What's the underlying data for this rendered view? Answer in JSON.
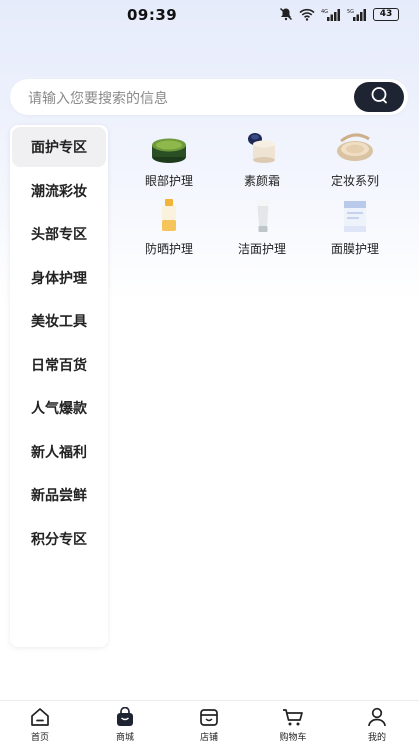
{
  "status_bar": {
    "time": "09:39",
    "battery": "43",
    "network_labels": [
      "4G",
      "5G"
    ]
  },
  "search": {
    "placeholder": "请输入您要搜索的信息",
    "icon": "search-icon"
  },
  "sidebar": {
    "active_index": 0,
    "items": [
      {
        "label": "面护专区"
      },
      {
        "label": "潮流彩妆"
      },
      {
        "label": "头部专区"
      },
      {
        "label": "身体护理"
      },
      {
        "label": "美妆工具"
      },
      {
        "label": "日常百货"
      },
      {
        "label": "人气爆款"
      },
      {
        "label": "新人福利"
      },
      {
        "label": "新品尝鲜"
      },
      {
        "label": "积分专区"
      }
    ]
  },
  "categories": [
    {
      "label": "眼部护理",
      "icon": "eye-patch-jar-icon"
    },
    {
      "label": "素颜霜",
      "icon": "cream-jar-icon"
    },
    {
      "label": "定妆系列",
      "icon": "powder-compact-icon"
    },
    {
      "label": "防晒护理",
      "icon": "sunscreen-bottle-icon"
    },
    {
      "label": "洁面护理",
      "icon": "cleanser-tube-icon"
    },
    {
      "label": "面膜护理",
      "icon": "face-mask-box-icon"
    }
  ],
  "tabs": [
    {
      "label": "首页",
      "icon": "home-icon"
    },
    {
      "label": "商城",
      "icon": "shopping-bag-icon",
      "active": true
    },
    {
      "label": "店铺",
      "icon": "store-icon"
    },
    {
      "label": "购物车",
      "icon": "cart-icon"
    },
    {
      "label": "我的",
      "icon": "user-icon"
    }
  ],
  "colors": {
    "search_button": "#1f2433",
    "header_gradient": "#e6ebfb",
    "active_sidebar_bg": "#f0f0f2"
  }
}
